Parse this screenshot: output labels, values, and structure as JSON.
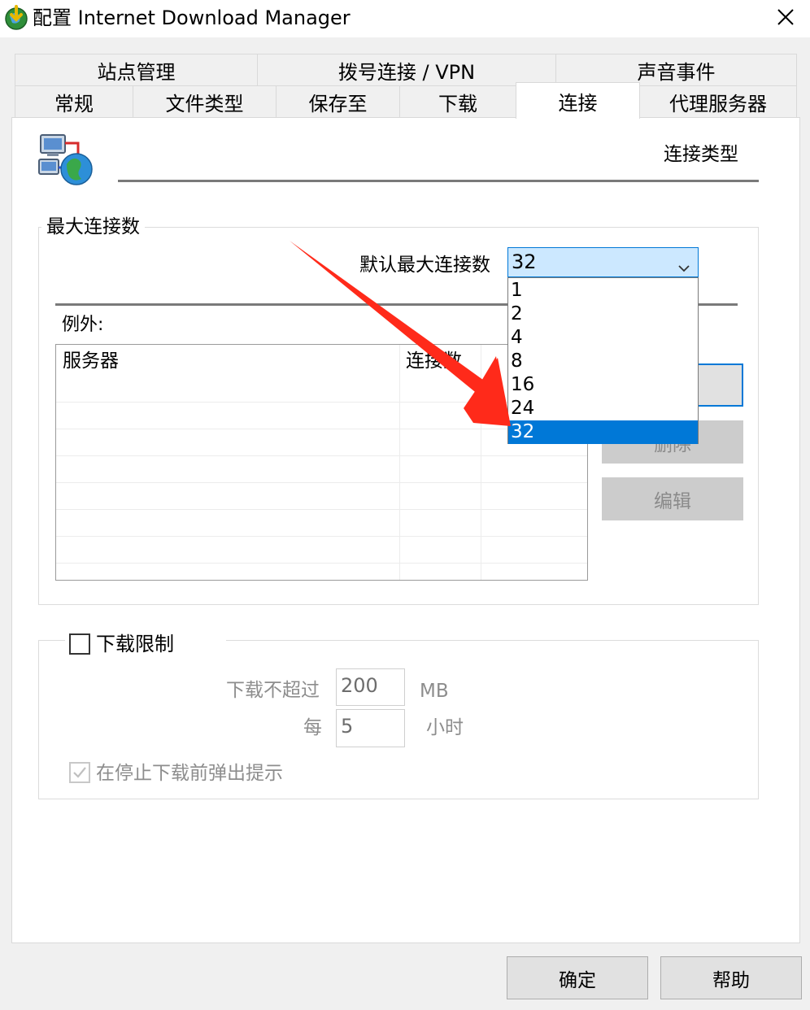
{
  "window": {
    "title": "配置 Internet Download Manager",
    "close_symbol": "✕"
  },
  "tabs": {
    "row1": [
      "站点管理",
      "拨号连接 / VPN",
      "声音事件"
    ],
    "row2": [
      "常规",
      "文件类型",
      "保存至",
      "下载",
      "连接",
      "代理服务器"
    ],
    "active": "连接"
  },
  "header": {
    "section_title": "连接类型"
  },
  "max_connections": {
    "group_label": "最大连接数",
    "default_label": "默认最大连接数",
    "selected_value": "32",
    "options": [
      "1",
      "2",
      "4",
      "8",
      "16",
      "24",
      "32"
    ],
    "exceptions_label": "例外:",
    "table_headers": [
      "服务器",
      "连接数"
    ],
    "buttons": {
      "delete": "删除",
      "edit": "编辑"
    }
  },
  "download_limit": {
    "checkbox_label": "下载限制",
    "checked": false,
    "amount_label": "下载不超过",
    "amount_value": "200",
    "amount_unit": "MB",
    "per_label": "每",
    "per_value": "5",
    "per_unit": "小时",
    "popup_label": "在停止下载前弹出提示",
    "popup_checked": true
  },
  "footer": {
    "ok": "确定",
    "help": "帮助"
  },
  "colors": {
    "accent": "#0078d7",
    "annotation_arrow": "#ff2a1a",
    "combo_highlight": "#cce8ff"
  }
}
